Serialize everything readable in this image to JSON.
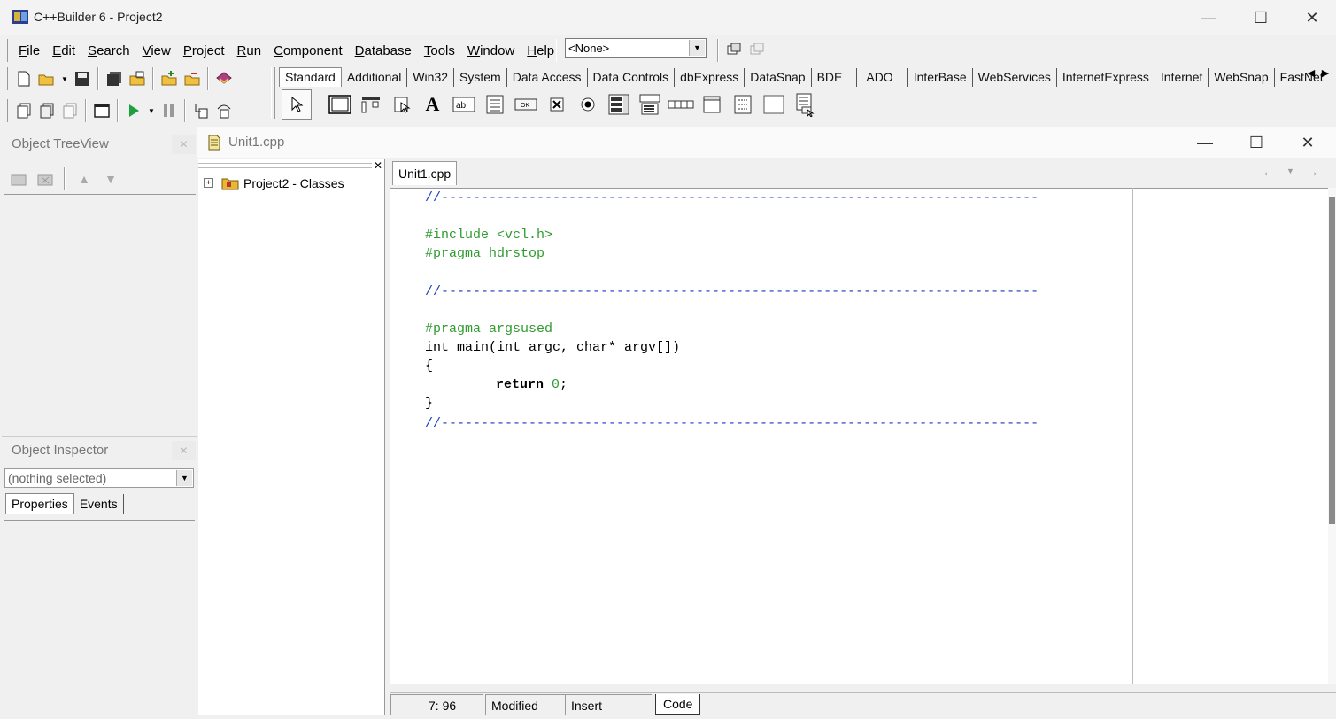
{
  "app": {
    "title": "C++Builder 6 - Project2"
  },
  "menu": [
    {
      "u": "F",
      "rest": "ile"
    },
    {
      "u": "E",
      "rest": "dit"
    },
    {
      "u": "S",
      "rest": "earch"
    },
    {
      "u": "V",
      "rest": "iew"
    },
    {
      "u": "P",
      "rest": "roject"
    },
    {
      "u": "R",
      "rest": "un"
    },
    {
      "u": "C",
      "rest": "omponent"
    },
    {
      "u": "D",
      "rest": "atabase"
    },
    {
      "u": "T",
      "rest": "ools"
    },
    {
      "u": "W",
      "rest": "indow"
    },
    {
      "u": "H",
      "rest": "elp"
    }
  ],
  "desktop_combo": {
    "value": "<None>"
  },
  "palette_tabs": [
    "Standard",
    "Additional",
    "Win32",
    "System",
    "Data Access",
    "Data Controls",
    "dbExpress",
    "DataSnap",
    "BDE",
    "ADO",
    "InterBase",
    "WebServices",
    "InternetExpress",
    "Internet",
    "WebSnap",
    "FastNet"
  ],
  "object_treeview": {
    "title": "Object TreeView"
  },
  "object_inspector": {
    "title": "Object Inspector",
    "selection": "(nothing selected)",
    "tabs": [
      "Properties",
      "Events"
    ]
  },
  "editor": {
    "title": "Unit1.cpp",
    "tab": "Unit1.cpp",
    "class_tree_root": "Project2 - Classes",
    "code": {
      "sep": "//---------------------------------------------------------------------------",
      "include": "#include <vcl.h>",
      "hdrstop": "#pragma hdrstop",
      "argsused": "#pragma argsused",
      "main_sig": "int main(int argc, char* argv[])",
      "open": "{",
      "ret_kw": "return",
      "ret_val": "0",
      "ret_end": ";",
      "close": "}"
    },
    "status": {
      "position": "7: 96",
      "modified": "Modified",
      "mode": "Insert",
      "view_tab": "Code"
    }
  },
  "colors": {
    "directive": "#2f9b2f",
    "comment": "#1f3fbf",
    "number": "#2f9b2f"
  }
}
